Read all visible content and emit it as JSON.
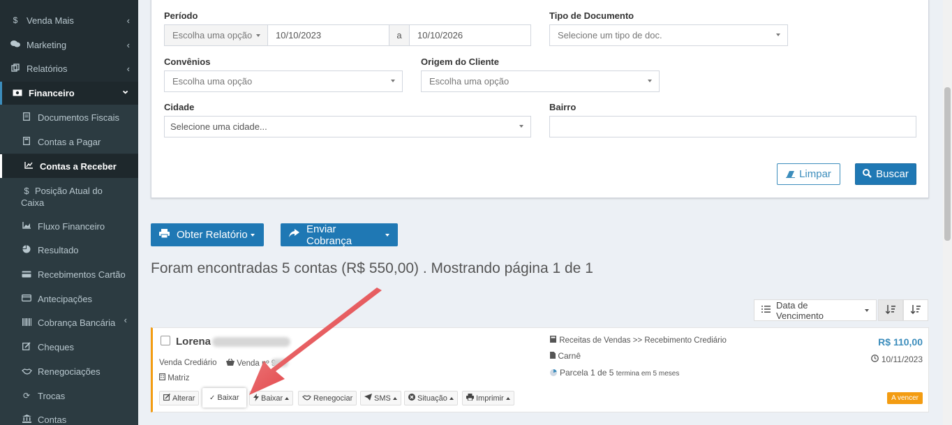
{
  "sidebar": {
    "items": [
      {
        "label": "Venda Mais",
        "icon": "dollar-icon",
        "chevron": "‹"
      },
      {
        "label": "Marketing",
        "icon": "comments-icon",
        "chevron": "‹"
      },
      {
        "label": "Relatórios",
        "icon": "copy-icon",
        "chevron": "‹"
      },
      {
        "label": "Financeiro",
        "icon": "money-icon",
        "chevron": "⌄"
      },
      {
        "label": "Documentos Fiscais",
        "icon": "file-icon"
      },
      {
        "label": "Contas a Pagar",
        "icon": "calculator-icon"
      },
      {
        "label": "Contas a Receber",
        "icon": "line-chart-icon"
      },
      {
        "label": "Posição Atual do",
        "label2": "Caixa",
        "icon": "dollar-icon"
      },
      {
        "label": "Fluxo Financeiro",
        "icon": "area-chart-icon"
      },
      {
        "label": "Resultado",
        "icon": "pie-chart-icon"
      },
      {
        "label": "Recebimentos Cartão",
        "icon": "credit-card-icon"
      },
      {
        "label": "Antecipações",
        "icon": "credit-card-alt-icon"
      },
      {
        "label": "Cobrança Bancária",
        "icon": "barcode-icon",
        "chevron": "‹"
      },
      {
        "label": "Cheques",
        "icon": "edit-icon"
      },
      {
        "label": "Renegociações",
        "icon": "handshake-icon"
      },
      {
        "label": "Trocas",
        "icon": "refresh-icon"
      },
      {
        "label": "Contas",
        "icon": "bank-icon"
      }
    ]
  },
  "filters": {
    "periodo_label": "Período",
    "periodo_option": "Escolha uma opção",
    "date_from": "10/10/2023",
    "date_sep": "a",
    "date_to": "10/10/2026",
    "tipo_doc_label": "Tipo de Documento",
    "tipo_doc_value": "Selecione um tipo de doc.",
    "convenios_label": "Convênios",
    "convenios_value": "Escolha uma opção",
    "origem_label": "Origem do Cliente",
    "origem_value": "Escolha uma opção",
    "cidade_label": "Cidade",
    "cidade_value": "Selecione uma cidade...",
    "bairro_label": "Bairro",
    "bairro_value": "",
    "limpar": "Limpar",
    "buscar": "Buscar"
  },
  "actions": {
    "obter_relatorio": "Obter Relatório",
    "enviar_cobranca": "Enviar Cobrança"
  },
  "summary": "Foram encontradas 5 contas (R$ 550,00) . Mostrando página 1 de 1",
  "sort": {
    "label": "Data de Vencimento"
  },
  "record": {
    "name": "Lorena",
    "venda_tipo": "Venda Crediário",
    "venda_num": "Venda nº 9",
    "loja": "Matriz",
    "categoria": "Receitas de Vendas >> Recebimento Crediário",
    "forma": "Carnê",
    "parcela": "Parcela 1 de 5",
    "parcela_extra": "termina em 5 meses",
    "valor": "R$ 110,00",
    "vencimento": "10/11/2023",
    "status": "A vencer",
    "buttons": {
      "alterar": "Alterar",
      "baixar": "Baixar",
      "baixar_menu": "Baixar",
      "renegociar": "Renegociar",
      "sms": "SMS",
      "situacao": "Situação",
      "imprimir": "Imprimir"
    }
  },
  "colors": {
    "sidebar_bg": "#222d32",
    "primary": "#1f78b4",
    "link": "#3c8dbc",
    "warning": "#f39c12",
    "arrow": "#e3262c"
  }
}
